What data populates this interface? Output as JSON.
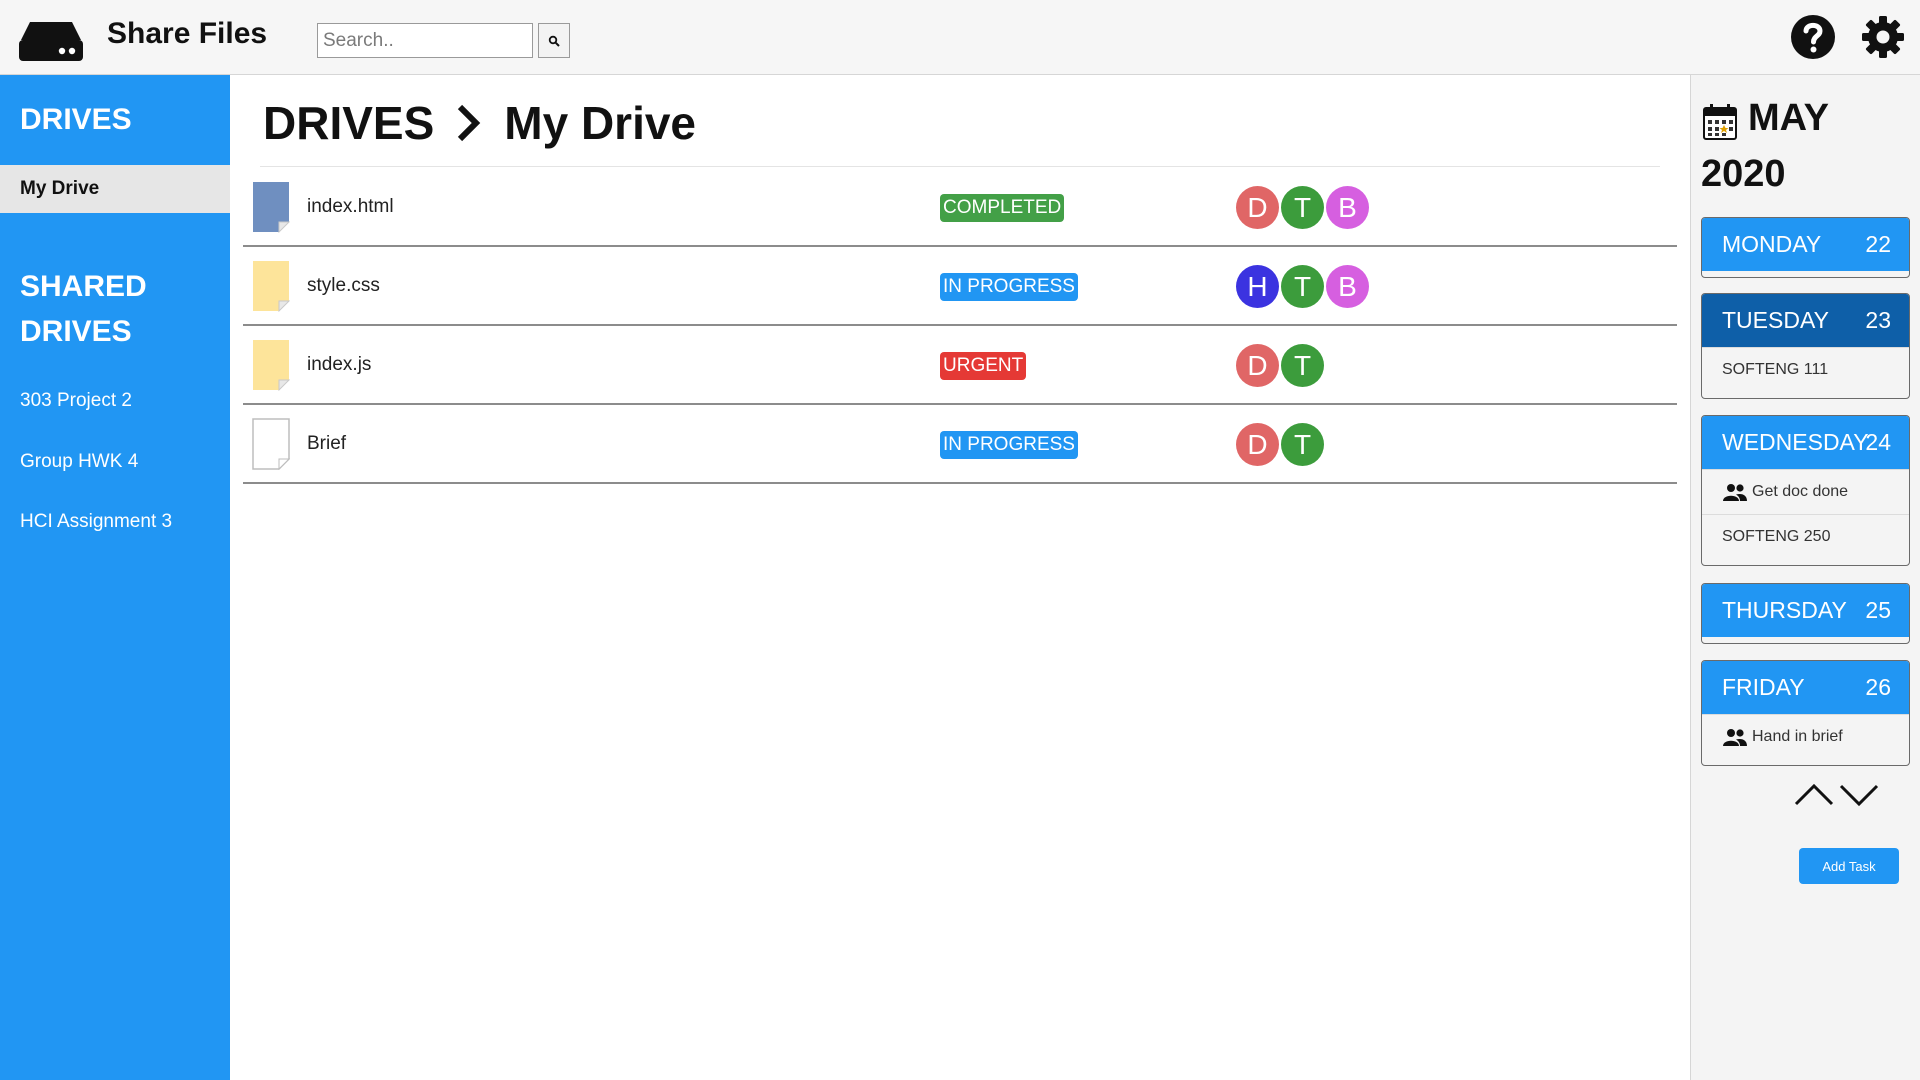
{
  "header": {
    "app_title": "Share Files",
    "search_placeholder": "Search..",
    "icons": [
      "drive-logo-icon",
      "search-icon",
      "help-icon",
      "gear-icon"
    ]
  },
  "sidebar": {
    "drives_heading": "DRIVES",
    "my_drive": "My Drive",
    "shared_heading_line1": "SHARED",
    "shared_heading_line2": "DRIVES",
    "shared_items": [
      "303 Project 2",
      "Group HWK 4",
      "HCI Assignment 3"
    ]
  },
  "main": {
    "breadcrumb_root": "DRIVES",
    "breadcrumb_current": "My Drive",
    "files": [
      {
        "name": "index.html",
        "status": "COMPLETED",
        "status_color": "#43a047",
        "icon_color": "#6f8fc0",
        "avatars": [
          {
            "letter": "D",
            "color": "#e06666"
          },
          {
            "letter": "T",
            "color": "#3c9c3c"
          },
          {
            "letter": "B",
            "color": "#d65fe0"
          }
        ]
      },
      {
        "name": "style.css",
        "status": "IN PROGRESS",
        "status_color": "#2196f3",
        "icon_color": "#fde49a",
        "avatars": [
          {
            "letter": "H",
            "color": "#3b33e0"
          },
          {
            "letter": "T",
            "color": "#3c9c3c"
          },
          {
            "letter": "B",
            "color": "#d65fe0"
          }
        ]
      },
      {
        "name": "index.js",
        "status": "URGENT",
        "status_color": "#e53935",
        "icon_color": "#fde49a",
        "avatars": [
          {
            "letter": "D",
            "color": "#e06666"
          },
          {
            "letter": "T",
            "color": "#3c9c3c"
          }
        ]
      },
      {
        "name": "Brief",
        "status": "IN PROGRESS",
        "status_color": "#2196f3",
        "icon_color": "#ffffff",
        "avatars": [
          {
            "letter": "D",
            "color": "#e06666"
          },
          {
            "letter": "T",
            "color": "#3c9c3c"
          }
        ]
      }
    ]
  },
  "calendar": {
    "month": "MAY",
    "year": "2020",
    "days": [
      {
        "name": "MONDAY",
        "date": "22",
        "tasks": []
      },
      {
        "name": "TUESDAY",
        "date": "23",
        "tasks": [
          {
            "text": "SOFTENG 111",
            "group": false
          }
        ]
      },
      {
        "name": "WEDNESDAY",
        "date": "24",
        "tasks": [
          {
            "text": "Get doc done",
            "group": true
          },
          {
            "text": "SOFTENG 250",
            "group": false
          }
        ]
      },
      {
        "name": "THURSDAY",
        "date": "25",
        "tasks": []
      },
      {
        "name": "FRIDAY",
        "date": "26",
        "tasks": [
          {
            "text": "Hand in brief",
            "group": true
          }
        ]
      }
    ],
    "add_task_label": "Add Task"
  }
}
